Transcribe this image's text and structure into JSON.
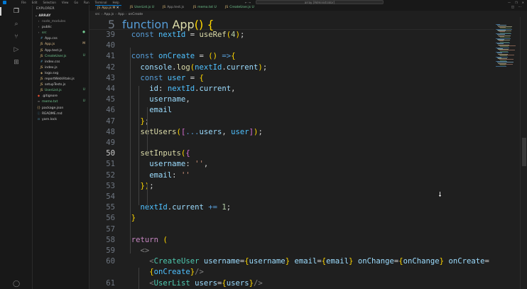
{
  "window": {
    "menu": [
      "File",
      "Edit",
      "Selection",
      "View",
      "Go",
      "Run",
      "Terminal",
      "Help"
    ],
    "command_center": "array [Administrator]",
    "controls": [
      "—",
      "❐",
      "✕"
    ]
  },
  "activity_bar": [
    "explorer",
    "search",
    "source-control",
    "run-debug",
    "extensions",
    "account"
  ],
  "explorer": {
    "title": "EXPLORER",
    "root": "ARRAY",
    "items": [
      {
        "label": "node_modules",
        "type": "folder",
        "depth": 1,
        "color": "#8a8a8a",
        "badge": ""
      },
      {
        "label": "public",
        "type": "folder",
        "depth": 1,
        "color": "#cccccc",
        "badge": ""
      },
      {
        "label": "src",
        "type": "folder",
        "depth": 1,
        "color": "#73c991",
        "badge": "●"
      },
      {
        "label": "App.css",
        "type": "css",
        "depth": 2,
        "color": "#cccccc",
        "badge": ""
      },
      {
        "label": "App.js",
        "type": "js",
        "depth": 2,
        "color": "#e2c08d",
        "badge": "M"
      },
      {
        "label": "App.test.js",
        "type": "js",
        "depth": 2,
        "color": "#cccccc",
        "badge": ""
      },
      {
        "label": "CreateUser.js",
        "type": "js",
        "depth": 2,
        "color": "#73c991",
        "badge": "U"
      },
      {
        "label": "index.css",
        "type": "css",
        "depth": 2,
        "color": "#cccccc",
        "badge": ""
      },
      {
        "label": "index.js",
        "type": "js",
        "depth": 2,
        "color": "#cccccc",
        "badge": ""
      },
      {
        "label": "logo.svg",
        "type": "svg",
        "depth": 2,
        "color": "#cccccc",
        "badge": ""
      },
      {
        "label": "reportWebVitals.js",
        "type": "js",
        "depth": 2,
        "color": "#cccccc",
        "badge": ""
      },
      {
        "label": "setupTests.js",
        "type": "js",
        "depth": 2,
        "color": "#cccccc",
        "badge": ""
      },
      {
        "label": "UserList.js",
        "type": "js",
        "depth": 2,
        "color": "#73c991",
        "badge": "U"
      },
      {
        "label": ".gitignore",
        "type": "git",
        "depth": 1,
        "color": "#cccccc",
        "badge": ""
      },
      {
        "label": "memo.txt",
        "type": "txt",
        "depth": 1,
        "color": "#73c991",
        "badge": "U"
      },
      {
        "label": "package.json",
        "type": "json",
        "depth": 1,
        "color": "#cccccc",
        "badge": ""
      },
      {
        "label": "README.md",
        "type": "md",
        "depth": 1,
        "color": "#cccccc",
        "badge": ""
      },
      {
        "label": "yarn.lock",
        "type": "lock",
        "depth": 1,
        "color": "#cccccc",
        "badge": ""
      }
    ]
  },
  "tabs": [
    {
      "label": "App.js",
      "badge": "M",
      "active": true,
      "color": "#e2c08d"
    },
    {
      "label": "UserList.js",
      "badge": "U",
      "active": false,
      "color": "#73c991"
    },
    {
      "label": "App.test.js",
      "badge": "",
      "active": false,
      "color": "#9d9d9d"
    },
    {
      "label": "memo.txt",
      "badge": "U",
      "active": false,
      "color": "#73c991"
    },
    {
      "label": "CreateUser.js",
      "badge": "U",
      "active": false,
      "color": "#73c991"
    }
  ],
  "breadcrumb": [
    "src",
    "App.js",
    "App",
    "onCreate"
  ],
  "sticky_line": {
    "number": "5",
    "text": "function App() {"
  },
  "code_lines": [
    {
      "n": "39",
      "text": "  const nextId = useRef(4);"
    },
    {
      "n": "40",
      "text": ""
    },
    {
      "n": "41",
      "text": "  const onCreate = () =>{"
    },
    {
      "n": "42",
      "text": "    console.log(nextId.current);"
    },
    {
      "n": "43",
      "text": "    const user = {"
    },
    {
      "n": "44",
      "text": "      id: nextId.current,"
    },
    {
      "n": "45",
      "text": "      username,"
    },
    {
      "n": "46",
      "text": "      email"
    },
    {
      "n": "47",
      "text": "    };"
    },
    {
      "n": "48",
      "text": "    setUsers([...users, user]);"
    },
    {
      "n": "49",
      "text": ""
    },
    {
      "n": "50",
      "text": "    setInputs({"
    },
    {
      "n": "51",
      "text": "      username: '',"
    },
    {
      "n": "52",
      "text": "      email: ''"
    },
    {
      "n": "53",
      "text": "    });"
    },
    {
      "n": "54",
      "text": ""
    },
    {
      "n": "55",
      "text": "    nextId.current += 1;"
    },
    {
      "n": "56",
      "text": "  }"
    },
    {
      "n": "57",
      "text": ""
    },
    {
      "n": "58",
      "text": "  return ("
    },
    {
      "n": "59",
      "text": "    <>"
    },
    {
      "n": "60",
      "text": "      <CreateUser username={username} email={email} onChange={onChange} onCreate="
    },
    {
      "n": "",
      "text": "      {onCreate}/>"
    },
    {
      "n": "61",
      "text": "      <UserList users={users}/>"
    }
  ],
  "current_line": "50"
}
